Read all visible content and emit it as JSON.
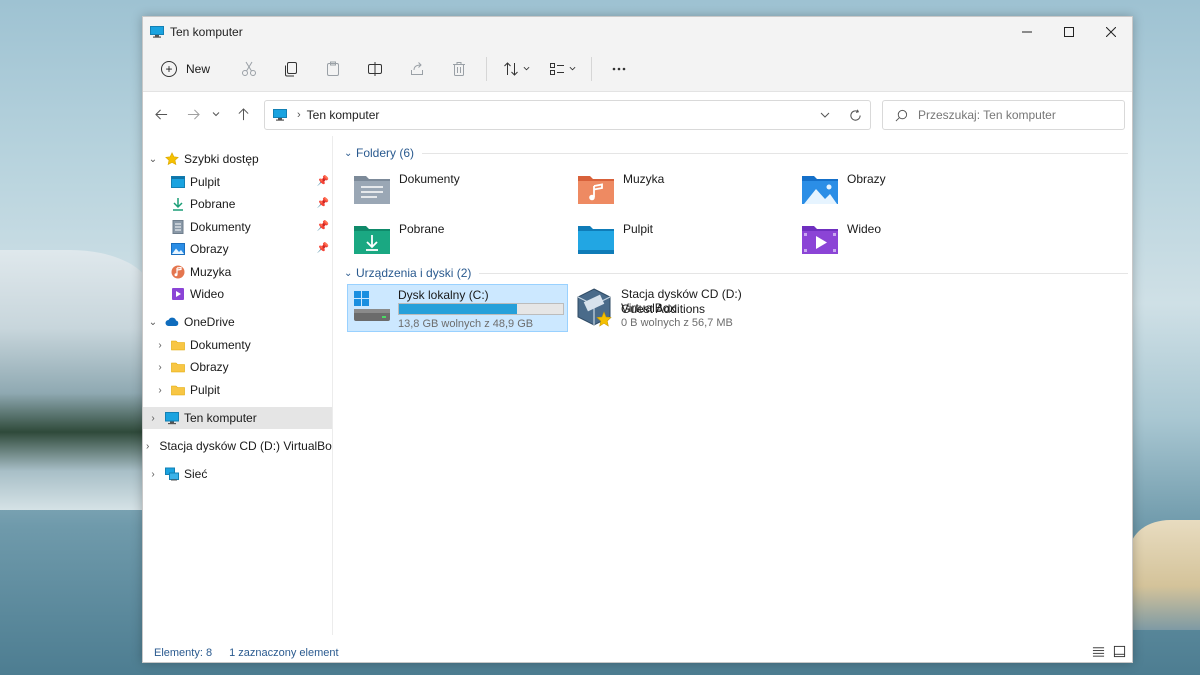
{
  "window": {
    "title": "Ten komputer"
  },
  "toolbar": {
    "new_label": "New"
  },
  "address": {
    "crumb": "Ten komputer"
  },
  "search": {
    "placeholder": "Przeszukaj: Ten komputer"
  },
  "sidebar": {
    "quick_access": "Szybki dostęp",
    "quick_items": [
      "Pulpit",
      "Pobrane",
      "Dokumenty",
      "Obrazy",
      "Muzyka",
      "Wideo"
    ],
    "onedrive": "OneDrive",
    "onedrive_items": [
      "Dokumenty",
      "Obrazy",
      "Pulpit"
    ],
    "this_pc": "Ten komputer",
    "cd_drive": "Stacja dysków CD (D:) VirtualBox",
    "network": "Sieć"
  },
  "folders": {
    "header": "Foldery (6)",
    "items": [
      "Dokumenty",
      "Muzyka",
      "Obrazy",
      "Pobrane",
      "Pulpit",
      "Wideo"
    ]
  },
  "devices": {
    "header": "Urządzenia i dyski (2)",
    "drive_c": {
      "name": "Dysk lokalny (C:)",
      "info": "13,8 GB wolnych z 48,9 GB",
      "used_fraction": 0.718
    },
    "drive_d": {
      "name_line1": "Stacja dysków CD (D:) VirtualBox",
      "name_line2": "Guest Additions",
      "info": "0 B wolnych z 56,7 MB"
    }
  },
  "status": {
    "items_count": "Elementy: 8",
    "selected": "1 zaznaczony element"
  },
  "colors": {
    "accent": "#26a0da",
    "selection_bg": "#cce8ff",
    "group_header": "#2a5a8f"
  }
}
